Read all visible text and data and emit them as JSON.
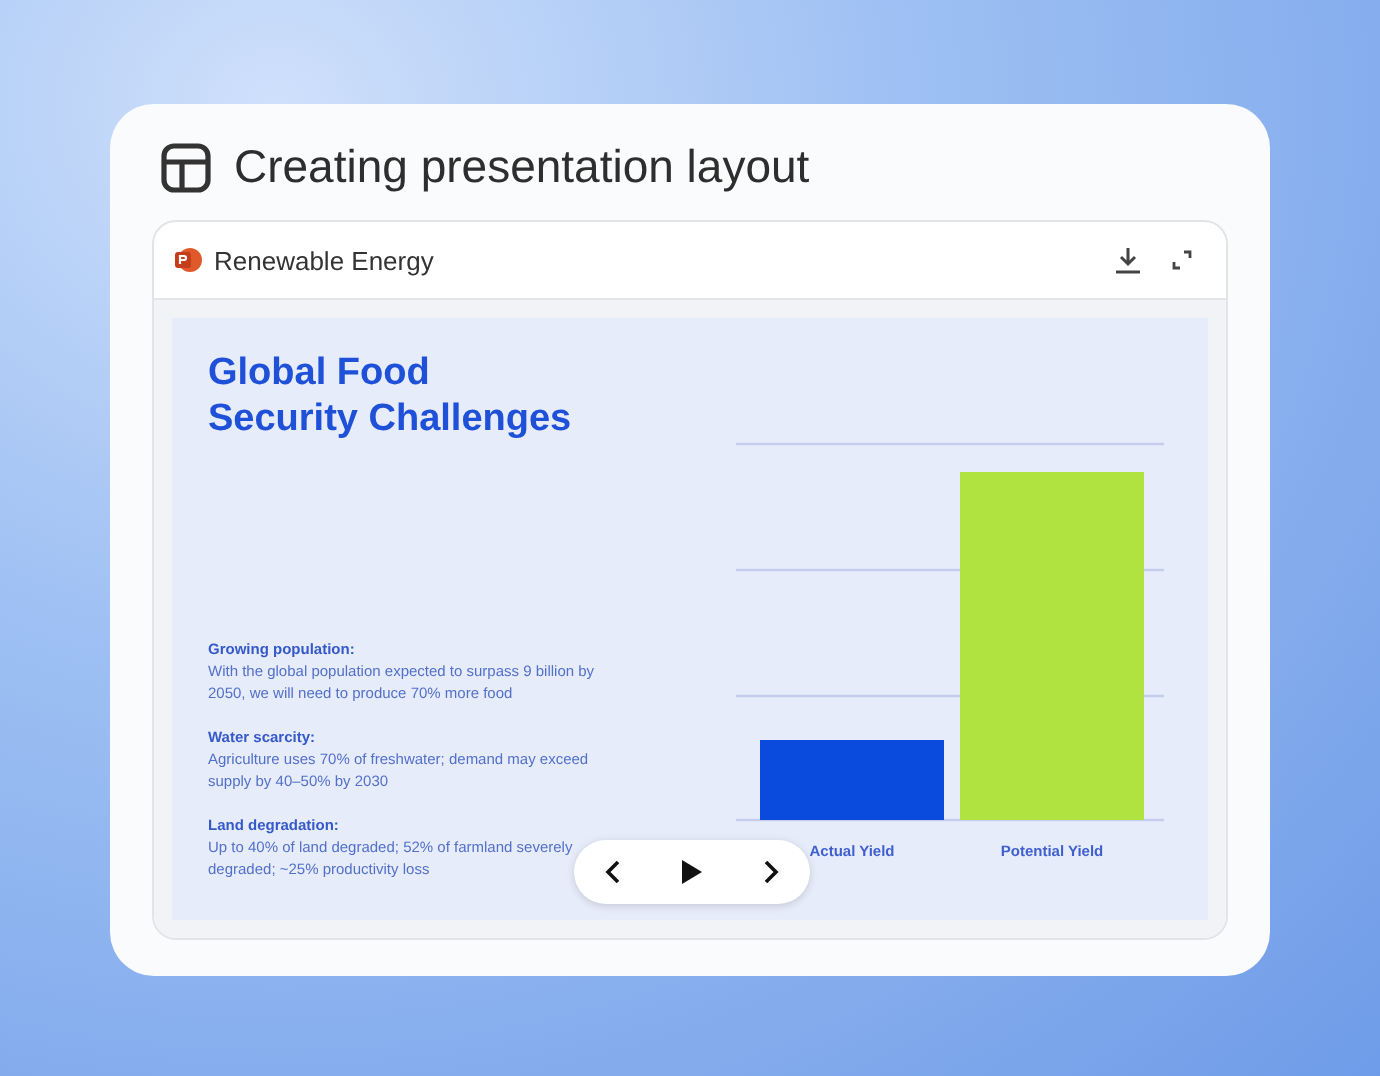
{
  "card": {
    "title": "Creating presentation layout"
  },
  "viewer": {
    "file_name": "Renewable Energy"
  },
  "slide": {
    "title_lines": [
      "Global Food",
      "Security Challenges"
    ],
    "points": [
      {
        "heading": "Growing population:",
        "text": "With the global population expected to surpass 9 billion by 2050, we will need to produce 70% more food"
      },
      {
        "heading": "Water scarcity:",
        "text": "Agriculture uses 70% of freshwater; demand may exceed supply by 40–50% by 2030"
      },
      {
        "heading": "Land degradation:",
        "text": "Up to 40% of land degraded; 52% of farmland severely degraded; ~25% productivity loss"
      }
    ],
    "chart_labels": [
      "Actual Yield",
      "Potential Yield"
    ]
  }
}
